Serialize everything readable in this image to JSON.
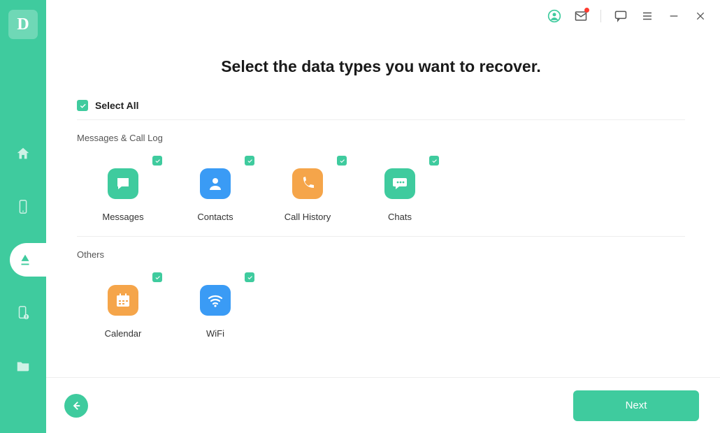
{
  "logo": "D",
  "title": "Select the data types you want to recover.",
  "selectAll": {
    "label": "Select All"
  },
  "sections": {
    "0": {
      "title": "Messages & Call Log"
    },
    "1": {
      "title": "Others"
    }
  },
  "items": {
    "messages": {
      "label": "Messages",
      "color": "#3fcb9e"
    },
    "contacts": {
      "label": "Contacts",
      "color": "#3a9bf5"
    },
    "callhistory": {
      "label": "Call History",
      "color": "#f5a54a"
    },
    "chats": {
      "label": "Chats",
      "color": "#3fcb9e"
    },
    "calendar": {
      "label": "Calendar",
      "color": "#f5a54a"
    },
    "wifi": {
      "label": "WiFi",
      "color": "#3a9bf5"
    }
  },
  "footer": {
    "next": "Next"
  }
}
